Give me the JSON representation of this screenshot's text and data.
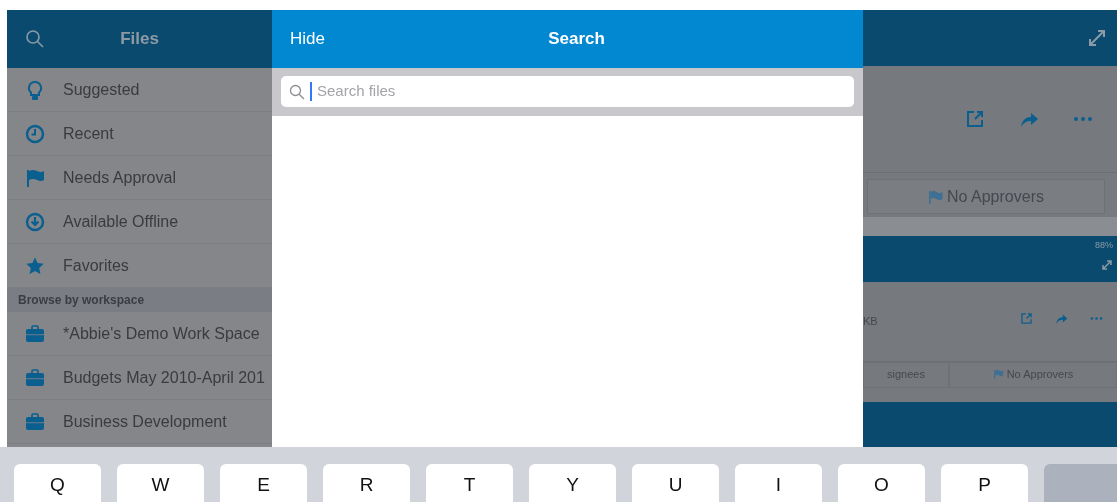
{
  "sidebar": {
    "title": "Files",
    "items": [
      {
        "label": "Suggested",
        "kind": "bulb"
      },
      {
        "label": "Recent",
        "kind": "clock"
      },
      {
        "label": "Needs Approval",
        "kind": "flag"
      },
      {
        "label": "Available Offline",
        "kind": "download"
      },
      {
        "label": "Favorites",
        "kind": "star"
      }
    ],
    "section": "Browse by workspace",
    "workspaces": [
      "*Abbie's Demo Work Space",
      "Budgets May 2010-April 201",
      "Business Development"
    ]
  },
  "search_panel": {
    "hide": "Hide",
    "title": "Search",
    "placeholder": "Search files"
  },
  "document_preview": {
    "approvers": "No Approvers",
    "thumbnail": {
      "battery": "88%",
      "size": "KB",
      "assignees": "signees",
      "approvers": "No Approvers"
    }
  },
  "keyboard": {
    "keys": [
      "Q",
      "W",
      "E",
      "R",
      "T",
      "Y",
      "U",
      "I",
      "O",
      "P"
    ]
  }
}
